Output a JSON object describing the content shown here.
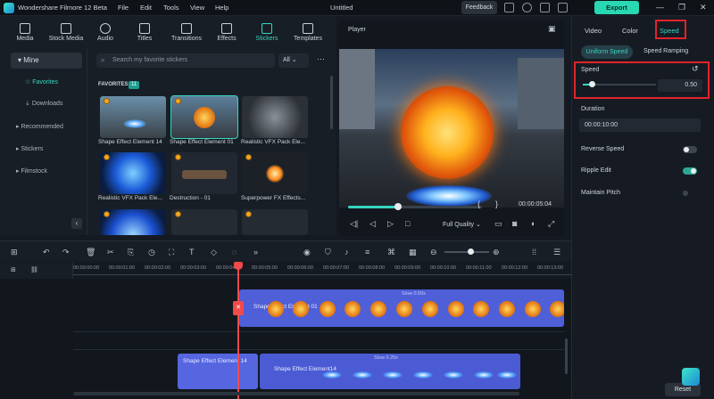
{
  "app": {
    "title": "Wondershare Filmore 12 Beta",
    "menu": [
      "File",
      "Edit",
      "Tools",
      "View",
      "Help"
    ],
    "project": "Untitled",
    "feedback": "Feedback",
    "export": "Export",
    "accent": "#34d6c0",
    "highlight": "#e0242b"
  },
  "media_tabs": [
    {
      "label": "Media",
      "icon": "media-icon"
    },
    {
      "label": "Stock Media",
      "icon": "stock-media-icon"
    },
    {
      "label": "Audio",
      "icon": "audio-icon"
    },
    {
      "label": "Titles",
      "icon": "titles-icon"
    },
    {
      "label": "Transitions",
      "icon": "transitions-icon"
    },
    {
      "label": "Effects",
      "icon": "effects-icon"
    },
    {
      "label": "Stickers",
      "icon": "stickers-icon",
      "active": true
    },
    {
      "label": "Templates",
      "icon": "templates-icon"
    }
  ],
  "left_panel": {
    "mine": "Mine",
    "items": [
      "Favorites",
      "Downloads",
      "Recommended",
      "Stickers",
      "Filmstock"
    ]
  },
  "stickers": {
    "search_placeholder": "Search my favorite stickers",
    "filter": "All",
    "section": "FAVORITES",
    "count": "11",
    "items": [
      "Shape Effect Element 14",
      "Shape Effect Element 01",
      "Realistic VFX Pack Ele...",
      "Realistic VFX Pack Ele...",
      "Destruction - 01",
      "Superpower FX Effects..."
    ]
  },
  "player": {
    "title": "Player",
    "timecode": "00:00:05:04",
    "quality": "Full Quality",
    "progress": 0.37
  },
  "properties": {
    "tabs": [
      "Video",
      "Color",
      "Speed"
    ],
    "active_tab": "Speed",
    "modes": [
      "Uniform Speed",
      "Speed Ramping"
    ],
    "speed_label": "Speed",
    "speed_value": "0.50",
    "speed_slider": 0.12,
    "duration_label": "Duration",
    "duration_value": "00:00:10:00",
    "reverse": "Reverse Speed",
    "ripple": "Ripple Edit",
    "pitch": "Maintain Pitch",
    "reset": "Reset"
  },
  "timeline": {
    "ticks": [
      "00:00:00:00",
      "00:00:01:00",
      "00:00:02:00",
      "00:00:03:00",
      "00:00:04:00",
      "00:00:05:00",
      "00:00:06:00",
      "00:00:07:00",
      "00:00:08:00",
      "00:00:09:00",
      "00:00:10:00",
      "00:00:11:00",
      "00:00:12:00",
      "00:00:13:00"
    ],
    "tracks": [
      "4",
      "3",
      "2"
    ],
    "clip1": {
      "label": "Shape Effect Element 01",
      "badge": "Slow 0.50x"
    },
    "clip2": {
      "label": "Shape Effect Element 14"
    },
    "clip3": {
      "label": "Shape Effect Element14",
      "badge": "Slow 0.25x"
    }
  }
}
